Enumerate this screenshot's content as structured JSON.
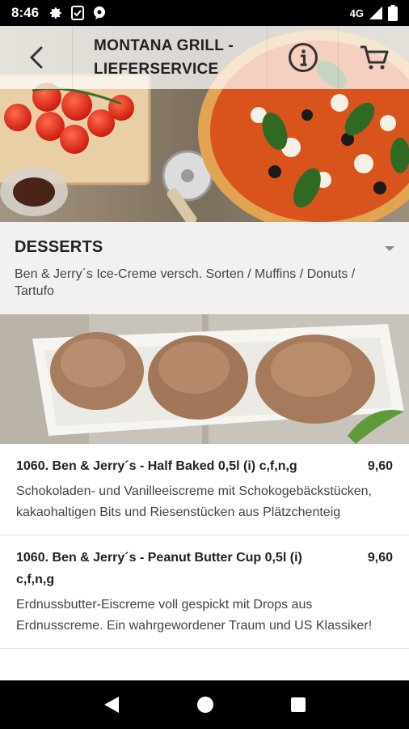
{
  "status_bar": {
    "time": "8:46",
    "network": "4G",
    "icons": [
      "gear-icon",
      "clipboard-icon",
      "chat-icon",
      "signal-icon",
      "battery-icon"
    ]
  },
  "header": {
    "title": "MONTANA GRILL -\nLIEFERSERVICE",
    "icons": [
      "back-arrow-icon",
      "info-icon",
      "cart-icon"
    ]
  },
  "category": {
    "title": "DESSERTS",
    "description": "Ben & Jerry´s Ice-Creme versch. Sorten / Muffins / Donuts / Tartufo"
  },
  "items": [
    {
      "name": "1060. Ben & Jerry´s - Half Baked 0,5l (i) c,f,n,g",
      "price": "9,60",
      "description": "Schokoladen- und Vanilleeiscreme mit Schokogebäckstücken, kakaohaltigen Bits und Riesenstücken aus Plätzchenteig"
    },
    {
      "name": "1060. Ben & Jerry´s - Peanut Butter Cup 0,5l (i) c,f,n,g",
      "price": "9,60",
      "description": "Erdnussbutter-Eiscreme voll gespickt mit Drops aus Erdnusscreme. Ein wahrgewordener Traum und US Klassiker!"
    }
  ],
  "nav_bar": {
    "icons": [
      "nav-back-icon",
      "nav-home-icon",
      "nav-recents-icon"
    ]
  },
  "colors": {
    "status_bar": "#000000",
    "category_bg": "#f1f1f1",
    "text": "#222222"
  }
}
